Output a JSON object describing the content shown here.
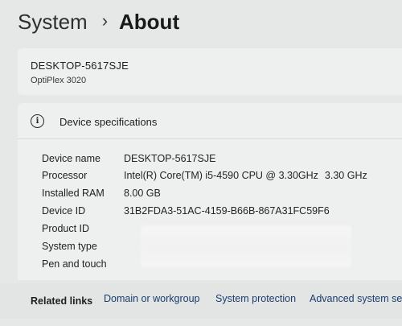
{
  "breadcrumb": {
    "parent": "System",
    "separator": "›",
    "current": "About"
  },
  "device": {
    "name": "DESKTOP-5617SJE",
    "model": "OptiPlex 3020"
  },
  "specs": {
    "icon": "info-icon",
    "title": "Device specifications",
    "rows": [
      {
        "label": "Device name",
        "value": "DESKTOP-5617SJE",
        "extra": ""
      },
      {
        "label": "Processor",
        "value": "Intel(R) Core(TM) i5-4590 CPU @ 3.30GHz",
        "extra": "3.30 GHz"
      },
      {
        "label": "Installed RAM",
        "value": "8.00 GB",
        "extra": ""
      },
      {
        "label": "Device ID",
        "value": "31B2FDA3-51AC-4159-B66B-867A31FC59F6",
        "extra": ""
      },
      {
        "label": "Product ID",
        "value": "",
        "extra": ""
      },
      {
        "label": "System type",
        "value": "",
        "extra": ""
      },
      {
        "label": "Pen and touch",
        "value": "",
        "extra": ""
      }
    ]
  },
  "related": {
    "label": "Related links",
    "links": [
      "Domain or workgroup",
      "System protection",
      "Advanced system sett"
    ]
  }
}
